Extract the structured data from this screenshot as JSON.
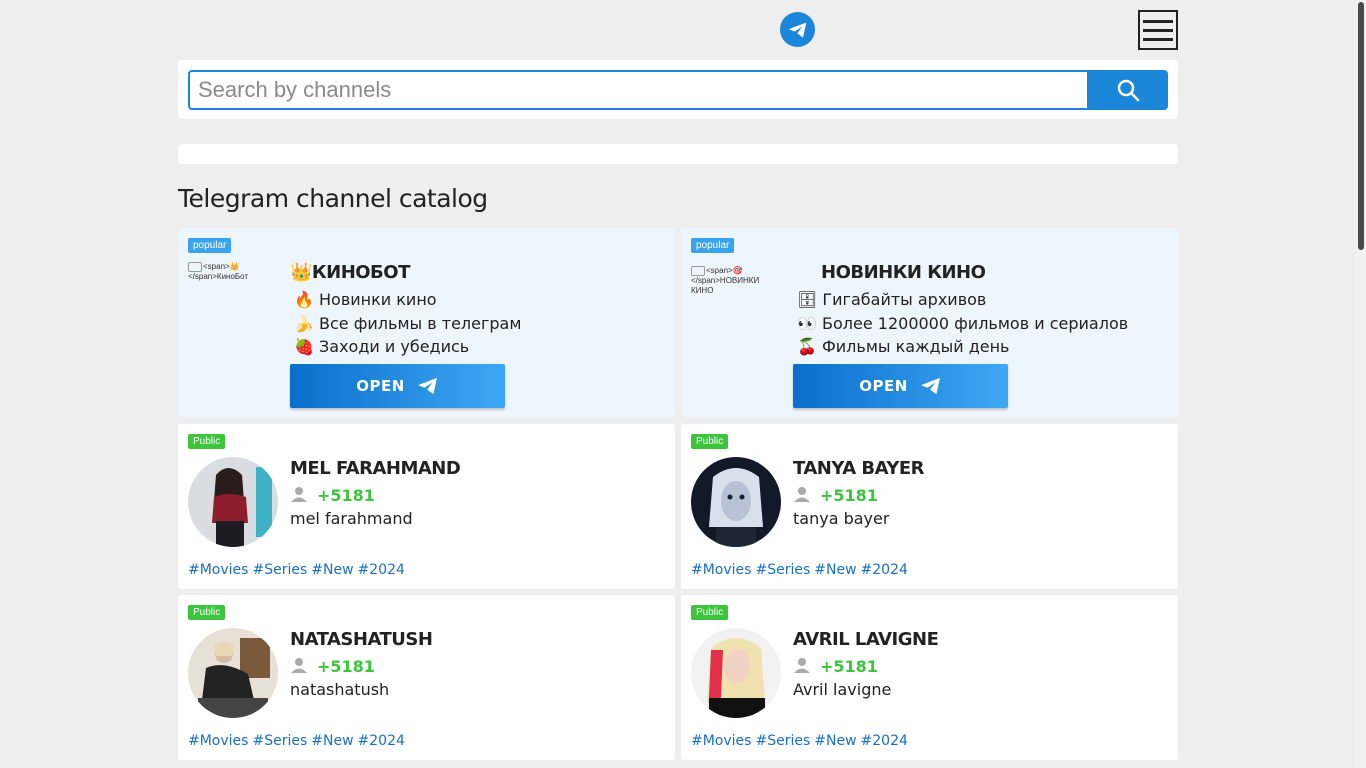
{
  "search": {
    "placeholder": "Search by channels"
  },
  "catalog_title": "Telegram channel catalog",
  "popular_cards": [
    {
      "badge": "popular",
      "img_alt": "<span>👑</span>КиноБот",
      "title": "👑КИНОБОТ",
      "lines": [
        "🔥 Новинки кино",
        "🍌 Все фильмы в телеграм",
        "🍓 Заходи и убедись"
      ],
      "button": "OPEN"
    },
    {
      "badge": "popular",
      "img_alt": "<span>🎯</span>НОВИНКИ КИНО",
      "title": "НОВИНКИ КИНО",
      "lines": [
        "🗄 Гигабайты архивов",
        "👀 Более 1200000 фильмов и сериалов",
        "🍒 Фильмы каждый день"
      ],
      "button": "OPEN"
    }
  ],
  "channels": [
    {
      "badge": "Public",
      "title": "MEL FARAHMAND",
      "count": "+5181",
      "desc": "mel farahmand",
      "tags": [
        "#Movies",
        "#Series",
        "#New",
        "#2024"
      ]
    },
    {
      "badge": "Public",
      "title": "TANYA BAYER",
      "count": "+5181",
      "desc": "tanya bayer",
      "tags": [
        "#Movies",
        "#Series",
        "#New",
        "#2024"
      ]
    },
    {
      "badge": "Public",
      "title": "NATASHATUSH",
      "count": "+5181",
      "desc": "natashatush",
      "tags": [
        "#Movies",
        "#Series",
        "#New",
        "#2024"
      ]
    },
    {
      "badge": "Public",
      "title": "AVRIL LAVIGNE",
      "count": "+5181",
      "desc": "Avril lavigne",
      "tags": [
        "#Movies",
        "#Series",
        "#New",
        "#2024"
      ]
    }
  ],
  "colors": {
    "accent": "#1c86d8",
    "public_badge": "#3cc43c",
    "popular_badge": "#3aa3ee",
    "tag": "#1a6fc0"
  }
}
